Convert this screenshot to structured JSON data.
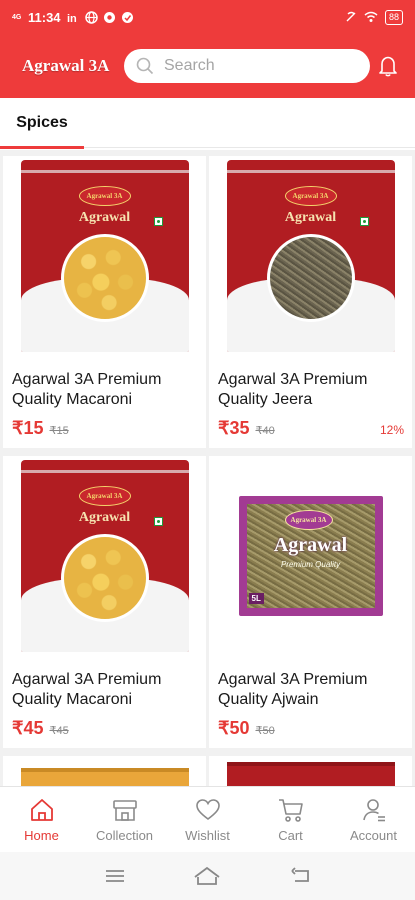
{
  "status_bar": {
    "time": "11:34",
    "network": "4G",
    "battery": "88"
  },
  "header": {
    "brand": "Agrawal 3A",
    "search_placeholder": "Search"
  },
  "tabs": [
    {
      "label": "Spices",
      "active": true
    }
  ],
  "products": [
    {
      "name": "Agarwal 3A Premium Quality Macaroni",
      "price": "₹15",
      "mrp": "₹15",
      "discount": "",
      "image": "macaroni-pouch"
    },
    {
      "name": "Agarwal 3A Premium Quality Jeera",
      "price": "₹35",
      "mrp": "₹40",
      "discount": "12%",
      "image": "jeera-pouch"
    },
    {
      "name": "Agarwal 3A Premium Quality Macaroni",
      "price": "₹45",
      "mrp": "₹45",
      "discount": "",
      "image": "macaroni-pouch"
    },
    {
      "name": "Agarwal 3A Premium Quality Ajwain",
      "price": "₹50",
      "mrp": "₹50",
      "discount": "",
      "image": "ajwain-packet"
    }
  ],
  "packet_text": {
    "logo": "Agrawal 3A",
    "brand_word": "Agrawal",
    "ajwain_sub": "Premium Quality",
    "ajwain_weight": "5L"
  },
  "bottom_nav": [
    {
      "label": "Home",
      "icon": "home-icon",
      "active": true
    },
    {
      "label": "Collection",
      "icon": "store-icon",
      "active": false
    },
    {
      "label": "Wishlist",
      "icon": "heart-icon",
      "active": false
    },
    {
      "label": "Cart",
      "icon": "cart-icon",
      "active": false
    },
    {
      "label": "Account",
      "icon": "account-icon",
      "active": false
    }
  ],
  "colors": {
    "brand_red": "#ee3b3b",
    "price_red": "#e53935",
    "inactive_gray": "#8a8a8a"
  }
}
